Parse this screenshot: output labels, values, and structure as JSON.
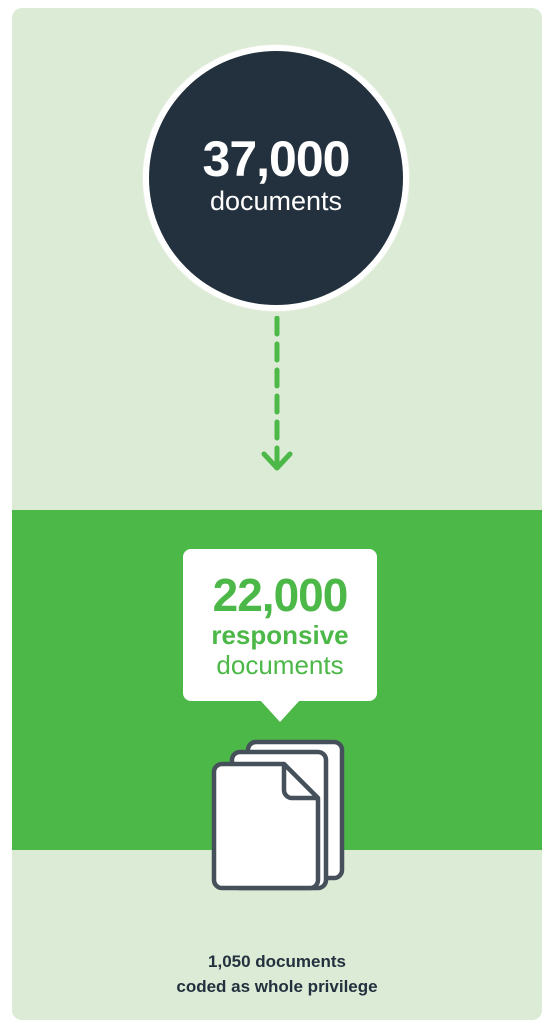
{
  "total": {
    "number": "37,000",
    "label": "documents"
  },
  "responsive": {
    "number": "22,000",
    "label_bold": "responsive",
    "label": "documents"
  },
  "privilege": {
    "line1": "1,050 documents",
    "line2": "coded as whole privilege"
  },
  "colors": {
    "background": "#dcebd5",
    "accent": "#4cb848",
    "dark": "#23313e"
  },
  "icons": {
    "arrow": "dashed-arrow-down-icon",
    "documents": "documents-stack-icon"
  }
}
